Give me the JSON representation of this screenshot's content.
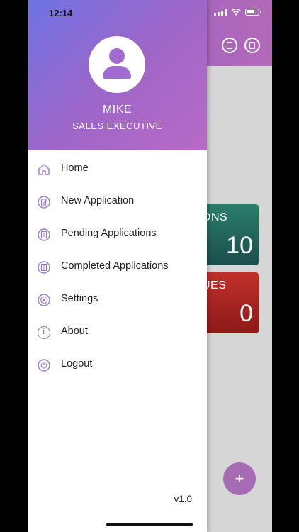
{
  "status": {
    "time": "12:14"
  },
  "user": {
    "name": "MIKE",
    "role": "SALES EXECUTIVE"
  },
  "menu": [
    {
      "label": "Home",
      "icon": "home-icon"
    },
    {
      "label": "New Application",
      "icon": "new-application-icon"
    },
    {
      "label": "Pending Applications",
      "icon": "pending-applications-icon"
    },
    {
      "label": "Completed Applications",
      "icon": "completed-applications-icon"
    },
    {
      "label": "Settings",
      "icon": "settings-icon"
    },
    {
      "label": "About",
      "icon": "about-icon"
    },
    {
      "label": "Logout",
      "icon": "logout-icon"
    }
  ],
  "version": "v1.0",
  "background": {
    "cards": [
      {
        "label_fragment": "ONS",
        "value": "10",
        "color": "#2a7d6a"
      },
      {
        "label_fragment": "UES",
        "value": "0",
        "color": "#c0302b"
      }
    ],
    "fab": {
      "label": "+"
    }
  },
  "colors": {
    "accent": "#9c7bd0",
    "header_start": "#6f73e4",
    "header_end": "#b96ac6"
  }
}
